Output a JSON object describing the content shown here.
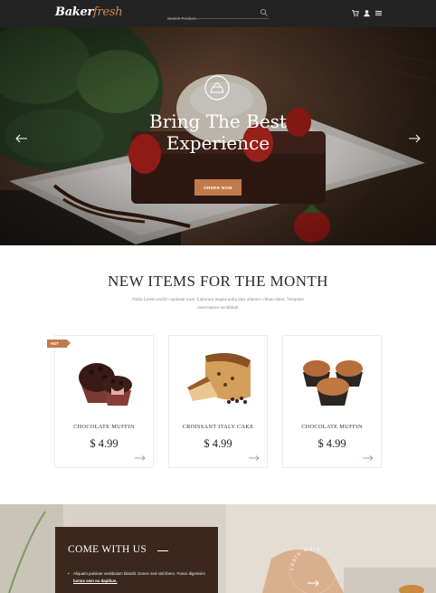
{
  "header": {
    "logo_part1": "Baker",
    "logo_part2": "fresh",
    "search_placeholder": "Search Product...",
    "icons": [
      "search-icon",
      "cart-icon",
      "user-icon",
      "menu-icon"
    ]
  },
  "hero": {
    "title_line1": "Bring The Best",
    "title_line2": "Experience",
    "button_label": "ORDER NOW"
  },
  "new_items": {
    "title": "NEW ITEMS FOR THE MONTH",
    "subtitle": "Nulla Lorem mollit cupidatat irure. Laborum magna nulla duis ullamco cillum dolor. Voluptate exercitation incididunt",
    "badge": "HOT",
    "products": [
      {
        "name": "CHOCOLATE MUFFIN",
        "price": "$ 4.99"
      },
      {
        "name": "CROISSANT ITALY CAKE",
        "price": "$ 4.99"
      },
      {
        "name": "CHOCOLATE MUFFIN",
        "price": "$ 4.99"
      }
    ]
  },
  "banner": {
    "title": "COME WITH US",
    "text": "Aliquam pulvinar vestibulum blandit. Donec sed nisl libero. Fusce dignissim",
    "link": "luctus sem eu dapibus.",
    "circle_text": "Learn more"
  },
  "colors": {
    "accent": "#c17b4b",
    "header_bg": "#232323",
    "banner_box": "#3b271b"
  }
}
